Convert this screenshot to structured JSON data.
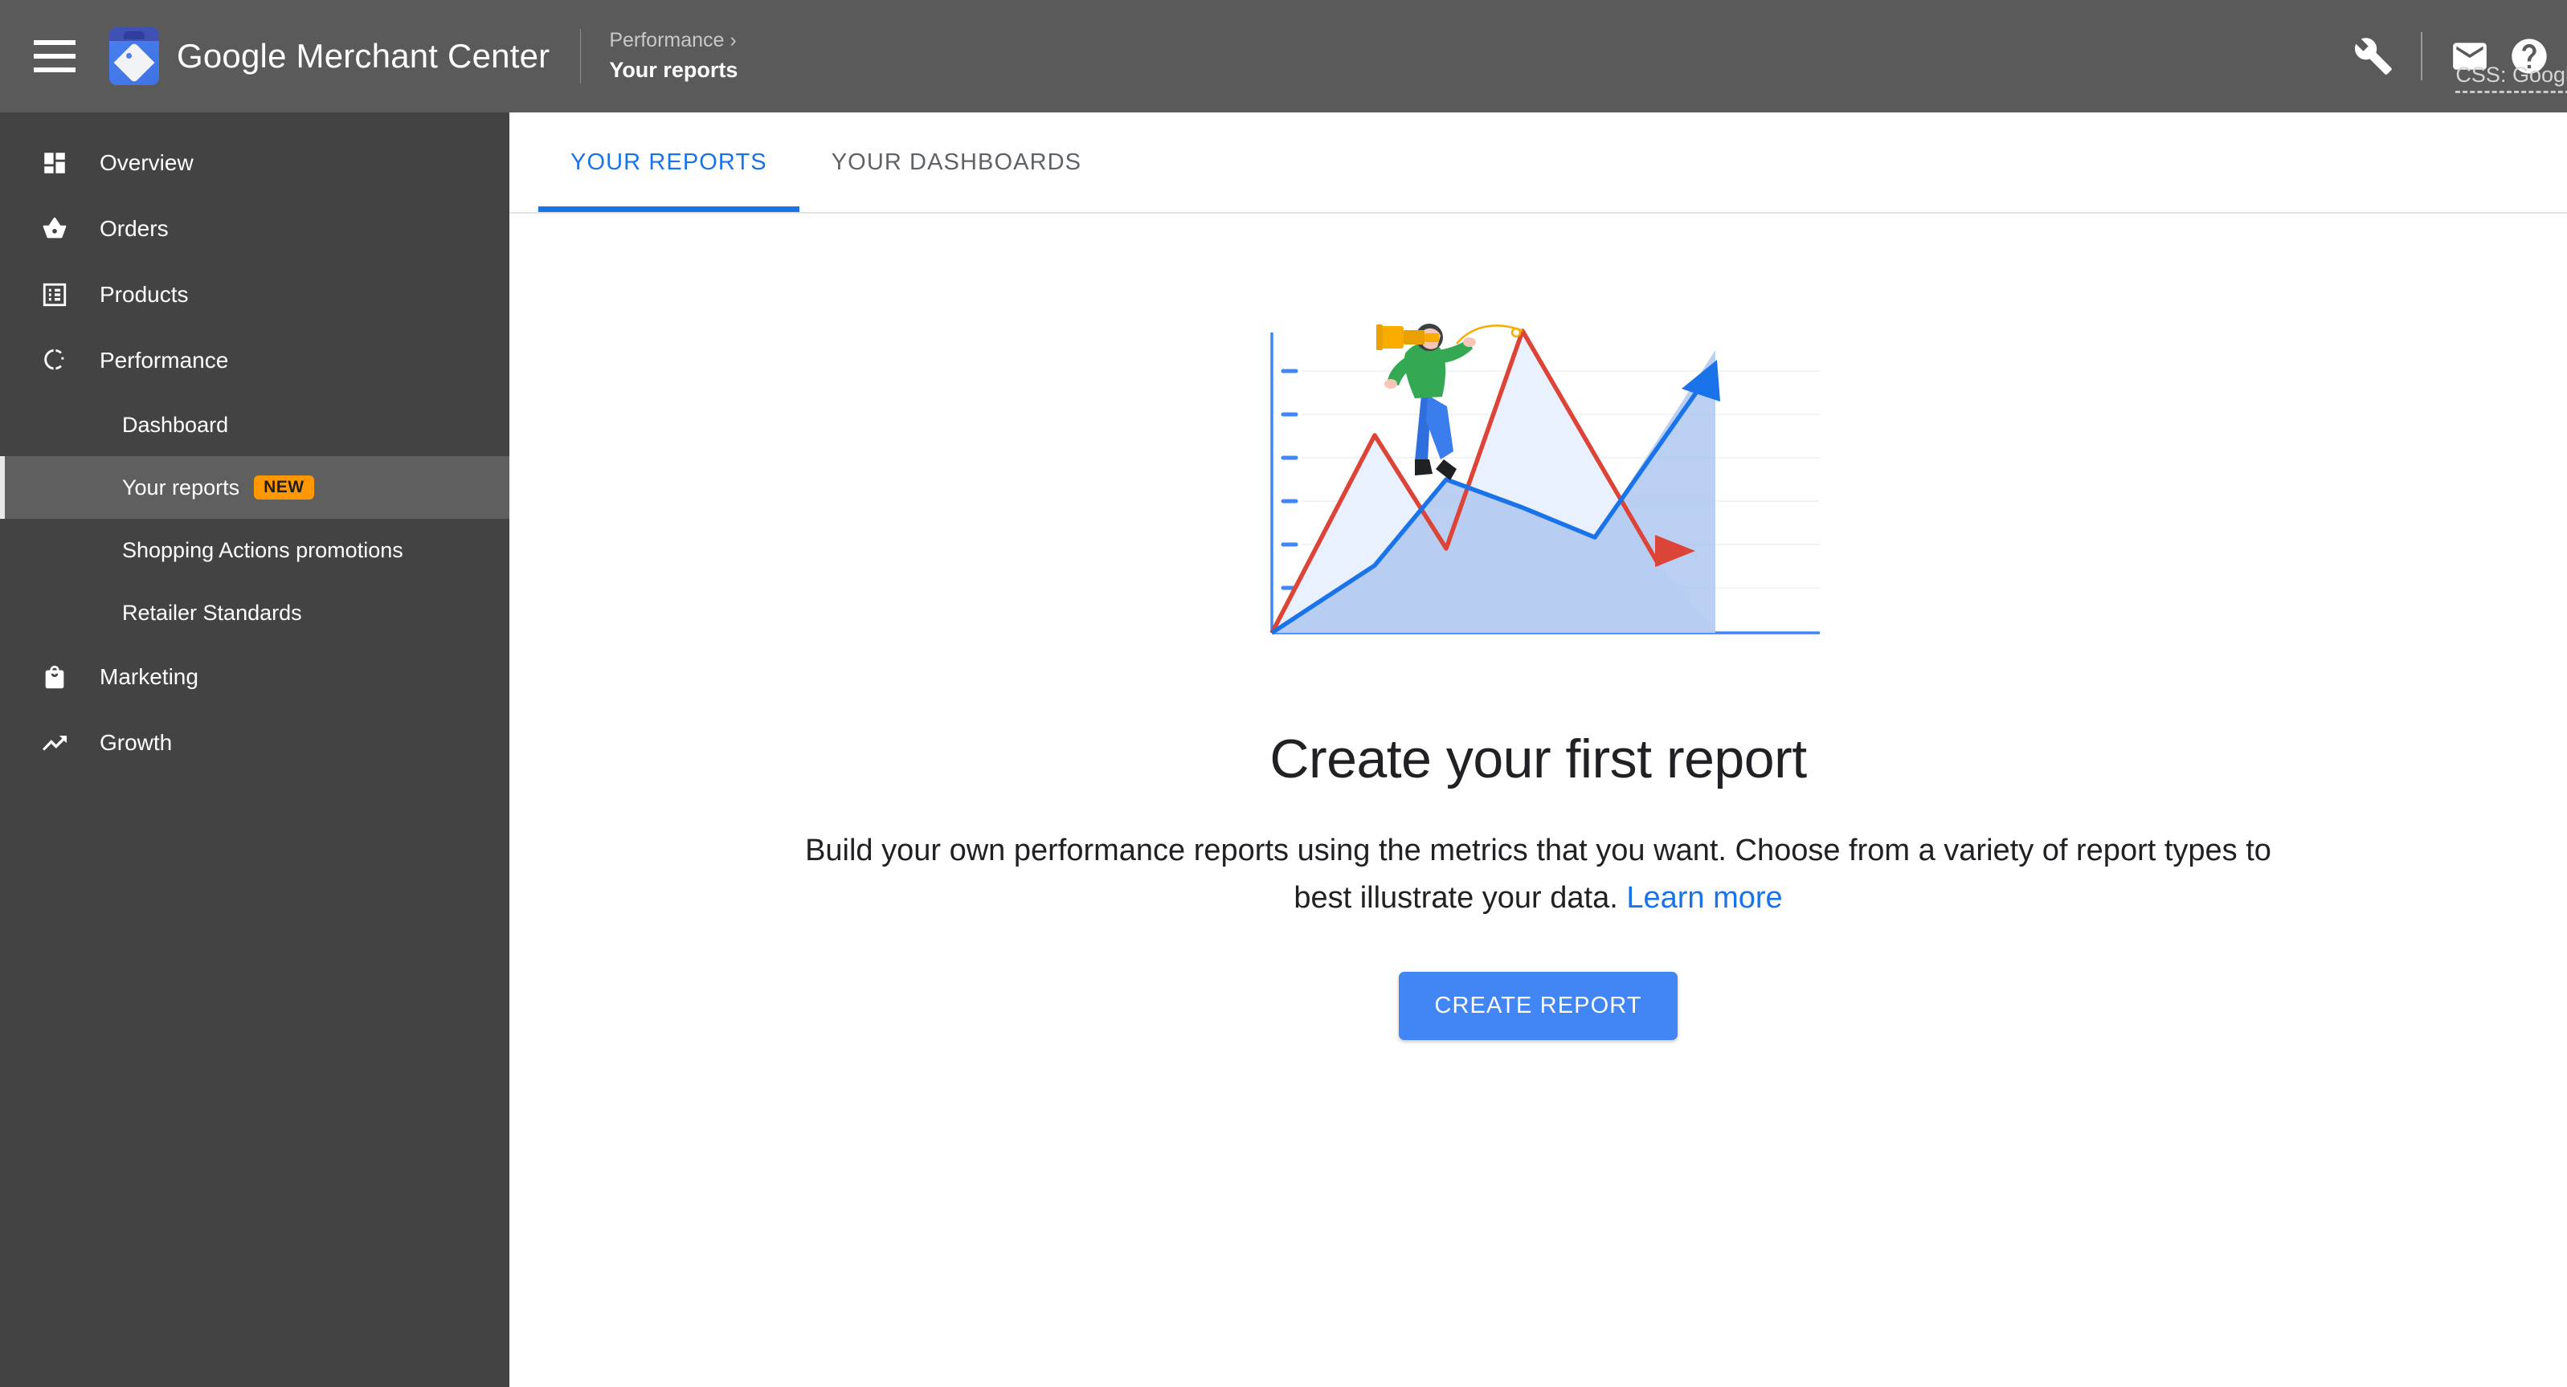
{
  "header": {
    "menu_icon": "hamburger-menu-icon",
    "logo_icon": "merchant-center-logo-icon",
    "brand": "Google Merchant Center",
    "breadcrumb_parent": "Performance",
    "breadcrumb_separator": "›",
    "breadcrumb_current": "Your reports",
    "tools_icon": "wrench-icon",
    "mail_icon": "mail-icon",
    "help_icon": "help-icon",
    "account_label": "CSS: Googl"
  },
  "sidebar": {
    "items": [
      {
        "label": "Overview",
        "icon": "dashboard-grid-icon",
        "type": "top"
      },
      {
        "label": "Orders",
        "icon": "basket-icon",
        "type": "top"
      },
      {
        "label": "Products",
        "icon": "list-table-icon",
        "type": "top"
      },
      {
        "label": "Performance",
        "icon": "donut-chart-icon",
        "type": "top"
      },
      {
        "label": "Dashboard",
        "type": "sub"
      },
      {
        "label": "Your reports",
        "type": "sub",
        "selected": true,
        "badge": "NEW"
      },
      {
        "label": "Shopping Actions promotions",
        "type": "sub"
      },
      {
        "label": "Retailer Standards",
        "type": "sub"
      },
      {
        "label": "Marketing",
        "icon": "shopping-bag-icon",
        "type": "top"
      },
      {
        "label": "Growth",
        "icon": "trending-up-icon",
        "type": "top"
      }
    ]
  },
  "main": {
    "tabs": [
      {
        "label": "YOUR REPORTS",
        "active": true
      },
      {
        "label": "YOUR DASHBOARDS",
        "active": false
      }
    ],
    "illustration_name": "person-with-telescope-on-line-chart-illustration",
    "headline": "Create your first report",
    "body_text": "Build your own performance reports using the metrics that you want. Choose from a variety of report types to best illustrate your data. ",
    "learn_more": "Learn more",
    "cta_label": "CREATE REPORT"
  },
  "colors": {
    "header_bg": "#5a5a5a",
    "sidebar_bg": "#434343",
    "sidebar_selected_bg": "#5f5f5f",
    "accent_blue": "#1a73e8",
    "button_blue": "#4285f4",
    "badge_orange": "#ff9800",
    "chart_red": "#db4437",
    "chart_blue": "#1a73e8"
  },
  "chart_data": {
    "type": "area",
    "title": "",
    "xlabel": "",
    "ylabel": "",
    "grid": true,
    "legend": "none",
    "x": [
      0,
      1,
      2,
      3,
      4,
      5,
      6
    ],
    "series": [
      {
        "name": "red-line",
        "color": "#db4437",
        "values": [
          0,
          62,
          24,
          100,
          30,
          0,
          0
        ]
      },
      {
        "name": "blue-line",
        "color": "#1a73e8",
        "values": [
          0,
          12,
          48,
          38,
          30,
          90,
          0
        ]
      }
    ],
    "y_ticks": 6
  }
}
